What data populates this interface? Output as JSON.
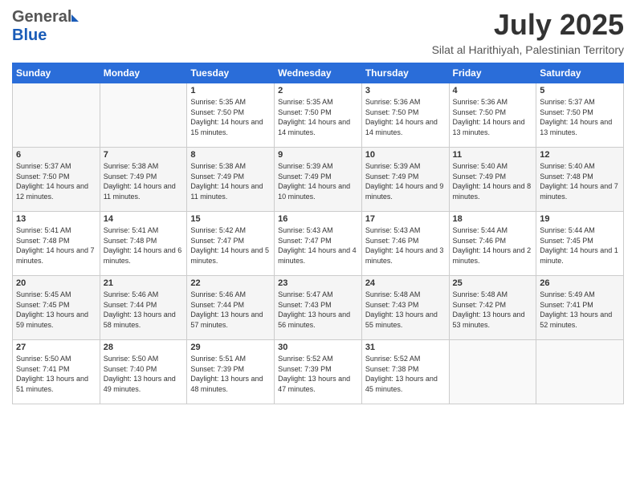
{
  "header": {
    "logo_general": "General",
    "logo_blue": "Blue",
    "month_year": "July 2025",
    "location": "Silat al Harithiyah, Palestinian Territory"
  },
  "days_of_week": [
    "Sunday",
    "Monday",
    "Tuesday",
    "Wednesday",
    "Thursday",
    "Friday",
    "Saturday"
  ],
  "weeks": [
    [
      {
        "day": "",
        "info": ""
      },
      {
        "day": "",
        "info": ""
      },
      {
        "day": "1",
        "info": "Sunrise: 5:35 AM\nSunset: 7:50 PM\nDaylight: 14 hours and 15 minutes."
      },
      {
        "day": "2",
        "info": "Sunrise: 5:35 AM\nSunset: 7:50 PM\nDaylight: 14 hours and 14 minutes."
      },
      {
        "day": "3",
        "info": "Sunrise: 5:36 AM\nSunset: 7:50 PM\nDaylight: 14 hours and 14 minutes."
      },
      {
        "day": "4",
        "info": "Sunrise: 5:36 AM\nSunset: 7:50 PM\nDaylight: 14 hours and 13 minutes."
      },
      {
        "day": "5",
        "info": "Sunrise: 5:37 AM\nSunset: 7:50 PM\nDaylight: 14 hours and 13 minutes."
      }
    ],
    [
      {
        "day": "6",
        "info": "Sunrise: 5:37 AM\nSunset: 7:50 PM\nDaylight: 14 hours and 12 minutes."
      },
      {
        "day": "7",
        "info": "Sunrise: 5:38 AM\nSunset: 7:49 PM\nDaylight: 14 hours and 11 minutes."
      },
      {
        "day": "8",
        "info": "Sunrise: 5:38 AM\nSunset: 7:49 PM\nDaylight: 14 hours and 11 minutes."
      },
      {
        "day": "9",
        "info": "Sunrise: 5:39 AM\nSunset: 7:49 PM\nDaylight: 14 hours and 10 minutes."
      },
      {
        "day": "10",
        "info": "Sunrise: 5:39 AM\nSunset: 7:49 PM\nDaylight: 14 hours and 9 minutes."
      },
      {
        "day": "11",
        "info": "Sunrise: 5:40 AM\nSunset: 7:49 PM\nDaylight: 14 hours and 8 minutes."
      },
      {
        "day": "12",
        "info": "Sunrise: 5:40 AM\nSunset: 7:48 PM\nDaylight: 14 hours and 7 minutes."
      }
    ],
    [
      {
        "day": "13",
        "info": "Sunrise: 5:41 AM\nSunset: 7:48 PM\nDaylight: 14 hours and 7 minutes."
      },
      {
        "day": "14",
        "info": "Sunrise: 5:41 AM\nSunset: 7:48 PM\nDaylight: 14 hours and 6 minutes."
      },
      {
        "day": "15",
        "info": "Sunrise: 5:42 AM\nSunset: 7:47 PM\nDaylight: 14 hours and 5 minutes."
      },
      {
        "day": "16",
        "info": "Sunrise: 5:43 AM\nSunset: 7:47 PM\nDaylight: 14 hours and 4 minutes."
      },
      {
        "day": "17",
        "info": "Sunrise: 5:43 AM\nSunset: 7:46 PM\nDaylight: 14 hours and 3 minutes."
      },
      {
        "day": "18",
        "info": "Sunrise: 5:44 AM\nSunset: 7:46 PM\nDaylight: 14 hours and 2 minutes."
      },
      {
        "day": "19",
        "info": "Sunrise: 5:44 AM\nSunset: 7:45 PM\nDaylight: 14 hours and 1 minute."
      }
    ],
    [
      {
        "day": "20",
        "info": "Sunrise: 5:45 AM\nSunset: 7:45 PM\nDaylight: 13 hours and 59 minutes."
      },
      {
        "day": "21",
        "info": "Sunrise: 5:46 AM\nSunset: 7:44 PM\nDaylight: 13 hours and 58 minutes."
      },
      {
        "day": "22",
        "info": "Sunrise: 5:46 AM\nSunset: 7:44 PM\nDaylight: 13 hours and 57 minutes."
      },
      {
        "day": "23",
        "info": "Sunrise: 5:47 AM\nSunset: 7:43 PM\nDaylight: 13 hours and 56 minutes."
      },
      {
        "day": "24",
        "info": "Sunrise: 5:48 AM\nSunset: 7:43 PM\nDaylight: 13 hours and 55 minutes."
      },
      {
        "day": "25",
        "info": "Sunrise: 5:48 AM\nSunset: 7:42 PM\nDaylight: 13 hours and 53 minutes."
      },
      {
        "day": "26",
        "info": "Sunrise: 5:49 AM\nSunset: 7:41 PM\nDaylight: 13 hours and 52 minutes."
      }
    ],
    [
      {
        "day": "27",
        "info": "Sunrise: 5:50 AM\nSunset: 7:41 PM\nDaylight: 13 hours and 51 minutes."
      },
      {
        "day": "28",
        "info": "Sunrise: 5:50 AM\nSunset: 7:40 PM\nDaylight: 13 hours and 49 minutes."
      },
      {
        "day": "29",
        "info": "Sunrise: 5:51 AM\nSunset: 7:39 PM\nDaylight: 13 hours and 48 minutes."
      },
      {
        "day": "30",
        "info": "Sunrise: 5:52 AM\nSunset: 7:39 PM\nDaylight: 13 hours and 47 minutes."
      },
      {
        "day": "31",
        "info": "Sunrise: 5:52 AM\nSunset: 7:38 PM\nDaylight: 13 hours and 45 minutes."
      },
      {
        "day": "",
        "info": ""
      },
      {
        "day": "",
        "info": ""
      }
    ]
  ]
}
